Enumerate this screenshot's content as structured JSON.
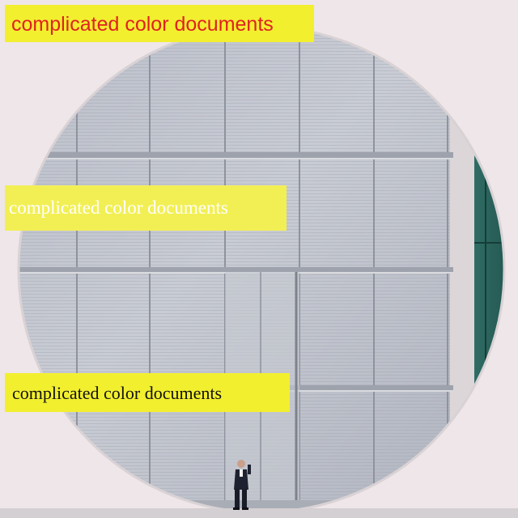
{
  "image": {
    "alt": "Circular building window with a man standing below"
  },
  "captions": [
    {
      "text": "complicated color documents",
      "color": "#e02222",
      "background": "#f2ef2f"
    },
    {
      "text": "complicated color documents",
      "color": "#ffffff",
      "background": "#f2ef55"
    },
    {
      "text": "complicated color documents",
      "color": "#111111",
      "background": "#f2ef2f"
    }
  ]
}
